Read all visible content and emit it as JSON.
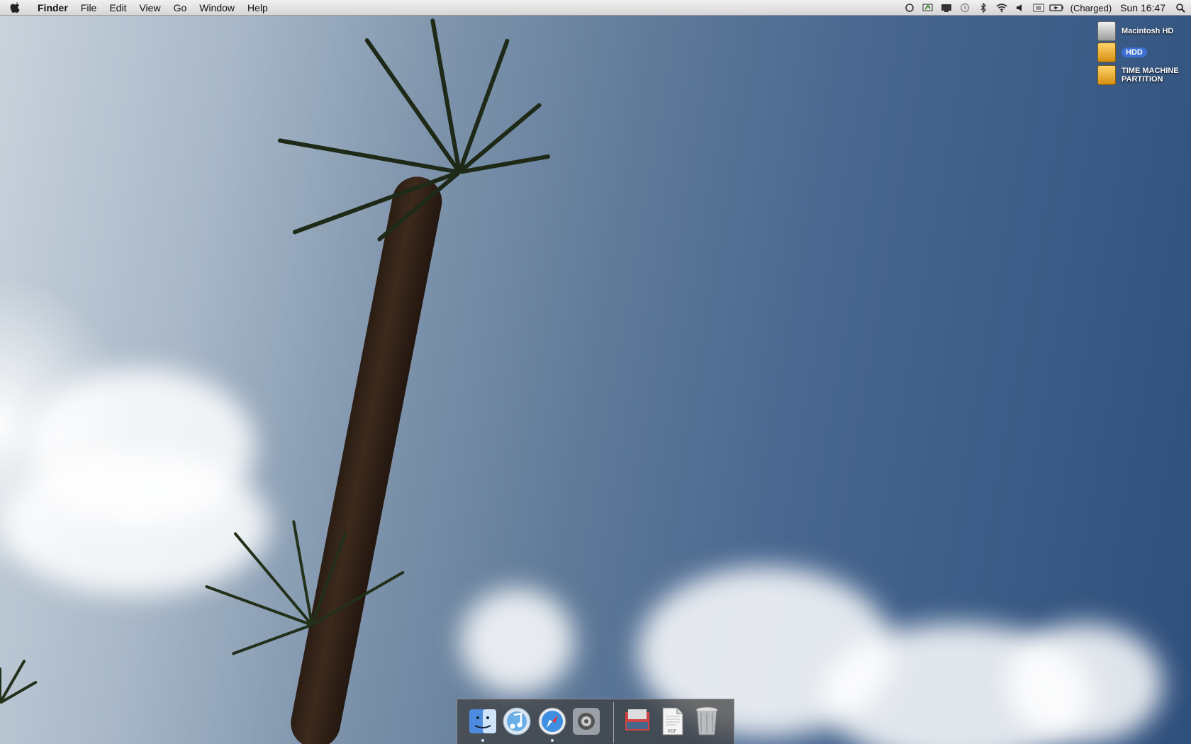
{
  "menubar": {
    "apple_icon": "apple-logo-icon",
    "app_name": "Finder",
    "menus": [
      "File",
      "Edit",
      "View",
      "Go",
      "Window",
      "Help"
    ],
    "status_icons": [
      "sync-icon",
      "gpu-switch-icon",
      "display-icon",
      "time-machine-icon",
      "bluetooth-icon",
      "wifi-icon",
      "volume-icon",
      "input-menu-icon",
      "battery-icon"
    ],
    "battery_status": "(Charged)",
    "clock": "Sun 16:47",
    "spotlight_icon": "spotlight-search-icon"
  },
  "desktop_icons": [
    {
      "label": "Macintosh HD",
      "icon": "internal-drive-icon",
      "color": "#d9d9d9",
      "selected": false
    },
    {
      "label": "HDD",
      "icon": "external-drive-icon",
      "color": "#f0b030",
      "selected": true
    },
    {
      "label": "TIME MACHINE PARTITION",
      "label_line1": "TIME MACHINE",
      "label_line2": "PARTITION",
      "icon": "external-drive-icon",
      "color": "#f0b030",
      "selected": false
    }
  ],
  "dock": {
    "apps": [
      {
        "name": "Finder",
        "icon": "finder-icon",
        "running": true
      },
      {
        "name": "iTunes",
        "icon": "itunes-icon",
        "running": false
      },
      {
        "name": "Safari",
        "icon": "safari-icon",
        "running": true
      },
      {
        "name": "System Preferences",
        "icon": "system-preferences-icon",
        "running": false
      }
    ],
    "others": [
      {
        "name": "Downloads stack",
        "icon": "downloads-stack-icon"
      },
      {
        "name": "PDF document",
        "icon": "pdf-document-icon",
        "badge": "PDF"
      },
      {
        "name": "Trash",
        "icon": "trash-icon"
      }
    ]
  },
  "colors": {
    "selection": "#3b6fd1",
    "sky_top": "#2f4f7c",
    "sky_light": "#c9d3dc"
  }
}
